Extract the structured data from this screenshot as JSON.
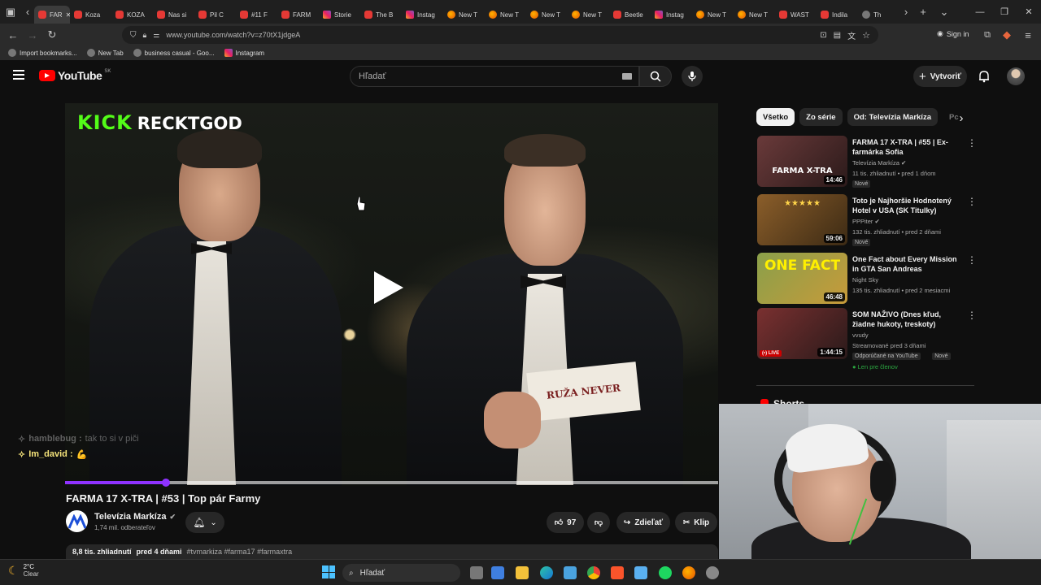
{
  "browser": {
    "tabs": [
      {
        "label": "FAR",
        "icon": "youtube-icon",
        "active": true
      },
      {
        "label": "Koza",
        "icon": "youtube-icon"
      },
      {
        "label": "KOZA",
        "icon": "youtube-icon"
      },
      {
        "label": "Nas si",
        "icon": "youtube-icon"
      },
      {
        "label": "Pil C",
        "icon": "youtube-icon"
      },
      {
        "label": "#11 F",
        "icon": "youtube-icon"
      },
      {
        "label": "FARM",
        "icon": "youtube-icon"
      },
      {
        "label": "Storie",
        "icon": "instagram-icon"
      },
      {
        "label": "The B",
        "icon": "youtube-icon"
      },
      {
        "label": "Instag",
        "icon": "instagram-icon"
      },
      {
        "label": "New T",
        "icon": "firefox-icon"
      },
      {
        "label": "New T",
        "icon": "firefox-icon"
      },
      {
        "label": "New T",
        "icon": "firefox-icon"
      },
      {
        "label": "New T",
        "icon": "firefox-icon"
      },
      {
        "label": "Beetle",
        "icon": "youtube-icon"
      },
      {
        "label": "Instag",
        "icon": "instagram-icon"
      },
      {
        "label": "New T",
        "icon": "firefox-icon"
      },
      {
        "label": "New T",
        "icon": "firefox-icon"
      },
      {
        "label": "WAST",
        "icon": "youtube-icon"
      },
      {
        "label": "Indila",
        "icon": "youtube-icon"
      },
      {
        "label": "Th",
        "icon": "generic-icon"
      }
    ],
    "url": "www.youtube.com/watch?v=z70tX1jdgeA",
    "sign_in": "Sign in",
    "bookmarks": [
      {
        "label": "Import bookmarks...",
        "icon": "import-icon"
      },
      {
        "label": "New Tab",
        "icon": "globe-icon"
      },
      {
        "label": "business casual - Goo...",
        "icon": "google-icon"
      },
      {
        "label": "Instagram",
        "icon": "instagram-icon"
      }
    ]
  },
  "youtube": {
    "logo_text": "YouTube",
    "logo_region": "SK",
    "search_placeholder": "Hľadať",
    "create_label": "Vytvoriť"
  },
  "player": {
    "overlay_brand": "KICK",
    "overlay_name": "RECKTGOD",
    "paper_text": "RUŽA NEVER",
    "progress_fraction": 0.155
  },
  "chat": [
    {
      "user": "hamblebug :",
      "message": "tak to si v piči"
    },
    {
      "user": "Im_david :",
      "message": "💪"
    }
  ],
  "video": {
    "title": "FARMA 17 X-TRA | #53 | Top pár Farmy",
    "channel": "Televízia Markíza",
    "subscribers": "1,74 mil. odberateľov",
    "likes": "97",
    "share_label": "Zdieľať",
    "clip_label": "Klip",
    "views": "8,8 tis. zhliadnutí",
    "date": "pred 4 dňami",
    "tags": "#tvmarkiza #farma17 #farmaxtra"
  },
  "sidebar": {
    "chips": [
      "Všetko",
      "Zo série",
      "Od: Televízia Markíza",
      "Pc"
    ],
    "recommendations": [
      {
        "title": "FARMA 17 X-TRA | #55 | Ex-farmárka Sofia",
        "channel": "Televízia Markíza",
        "verified": true,
        "meta": "11 tis. zhliadnutí • pred 1 dňom",
        "badges": [
          "Nové"
        ],
        "duration": "14:46",
        "live": false,
        "thumb_text": "FARMA X-TRA"
      },
      {
        "title": "Toto je Najhoršie Hodnotený Hotel v USA (SK Titulky)",
        "channel": "PPPiter",
        "verified": true,
        "meta": "132 tis. zhliadnutí • pred 2 dňami",
        "badges": [
          "Nové"
        ],
        "duration": "59:06",
        "live": false,
        "thumb_text": "★★★★★"
      },
      {
        "title": "One Fact about Every Mission in GTA San Andreas",
        "channel": "Night Sky",
        "verified": false,
        "meta": "135 tis. zhliadnutí • pred 2 mesiacmi",
        "badges": [],
        "duration": "46:48",
        "live": false,
        "thumb_text": "ONE FACT"
      },
      {
        "title": "SOM NAŽIVO (Dnes kľud, žiadne hukoty, treskoty)",
        "channel": "vvudy",
        "verified": false,
        "meta": "Streamované pred 3 dňami",
        "badges": [
          "Odporúčané na YouTube",
          "Nové"
        ],
        "members": "Len pre členov",
        "duration": "1:44:15",
        "live": true,
        "live_label": "(•) LIVE"
      }
    ],
    "shorts_label": "Shorts"
  },
  "taskbar": {
    "temperature": "2°C",
    "condition": "Clear",
    "search_placeholder": "Hľadať"
  },
  "colors": {
    "youtube_red": "#ff0000",
    "progress_purple": "#8f32ff",
    "kick_green": "#53fc18",
    "background": "#0f0f0f"
  }
}
